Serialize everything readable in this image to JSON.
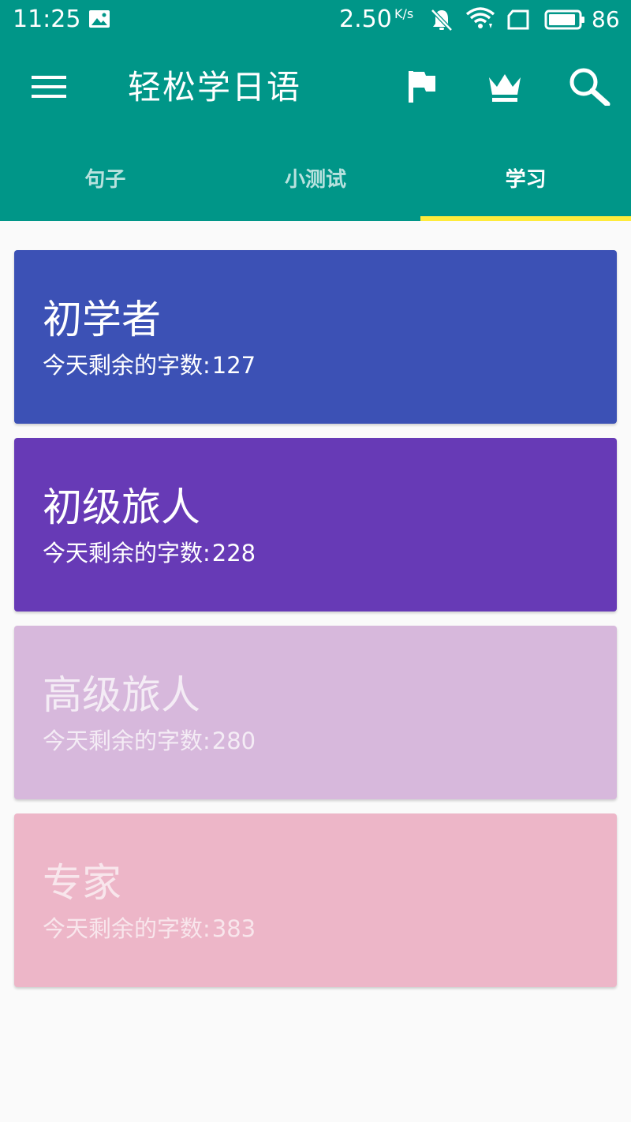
{
  "status_bar": {
    "time": "11:25",
    "speed": "2.50",
    "speed_unit": "K/s",
    "battery_level": "86"
  },
  "app_bar": {
    "title": "轻松学日语",
    "actions": [
      "flag-icon",
      "crown-icon",
      "search-icon"
    ]
  },
  "tabs": [
    {
      "label": "句子",
      "active": false
    },
    {
      "label": "小测试",
      "active": false
    },
    {
      "label": "学习",
      "active": true
    }
  ],
  "levels": [
    {
      "title": "初学者",
      "remaining_label": "今天剩余的字数:",
      "remaining": "127",
      "bg": "#3c51b5",
      "fg": "#ffffff"
    },
    {
      "title": "初级旅人",
      "remaining_label": "今天剩余的字数:",
      "remaining": "228",
      "bg": "#673ab6",
      "fg": "#ffffff"
    },
    {
      "title": "高级旅人",
      "remaining_label": "今天剩余的字数:",
      "remaining": "280",
      "bg": "#d7b8dc",
      "fg": "#f4ecf5"
    },
    {
      "title": "专家",
      "remaining_label": "今天剩余的字数:",
      "remaining": "383",
      "bg": "#edb6c8",
      "fg": "#f8e6ec"
    }
  ],
  "colors": {
    "primary": "#009688",
    "tab_indicator": "#ffeb3b",
    "background": "#fafafa"
  }
}
